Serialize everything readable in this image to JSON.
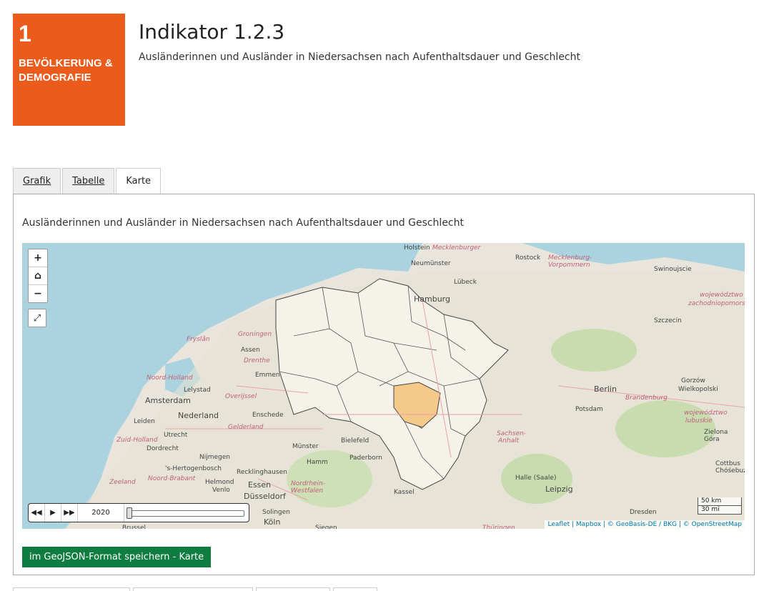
{
  "badge": {
    "number": "1",
    "category": "BEVÖLKERUNG & DEMOGRAFIE",
    "color": "#ea5b1c"
  },
  "header": {
    "title": "Indikator 1.2.3",
    "subtitle": "Ausländerinnen und Ausländer in Niedersachsen nach Aufenthaltsdauer und Geschlecht"
  },
  "tabs": [
    {
      "label": "Grafik"
    },
    {
      "label": "Tabelle"
    },
    {
      "label": "Karte"
    }
  ],
  "active_tab": "Karte",
  "panel": {
    "title": "Ausländerinnen und Ausländer in Niedersachsen nach Aufenthaltsdauer und Geschlecht"
  },
  "map": {
    "controls": {
      "zoom_in": "+",
      "home_icon": "home-icon",
      "zoom_out": "−",
      "fullscreen_icon": "fullscreen-icon"
    },
    "timebar": {
      "year": "2020",
      "rewind_icon": "rewind-icon",
      "play_icon": "play-icon",
      "forward_icon": "forward-icon"
    },
    "scale": {
      "km": "50 km",
      "mi": "30 mi"
    },
    "attribution": "Leaflet | Mapbox | © GeoBasis-DE / BKG | © OpenStreetMap",
    "highlight_color": "#f5c98a",
    "labels": [
      {
        "text": "Holstein",
        "cls": ""
      },
      {
        "text": "Mecklenburger",
        "cls": "region"
      },
      {
        "text": "Rostock",
        "cls": ""
      },
      {
        "text": "Mecklenburg-",
        "cls": "region"
      },
      {
        "text": "Vorpommern",
        "cls": "region"
      },
      {
        "text": "Neumünster",
        "cls": ""
      },
      {
        "text": "Lübeck",
        "cls": ""
      },
      {
        "text": "Swinoujscie",
        "cls": ""
      },
      {
        "text": "Hamburg",
        "cls": "big"
      },
      {
        "text": "województwo",
        "cls": "region"
      },
      {
        "text": "zachodniopomorskie",
        "cls": "region"
      },
      {
        "text": "Szczecin",
        "cls": ""
      },
      {
        "text": "Fryslân",
        "cls": "region"
      },
      {
        "text": "Groningen",
        "cls": "region"
      },
      {
        "text": "Assen",
        "cls": ""
      },
      {
        "text": "Drenthe",
        "cls": "region"
      },
      {
        "text": "Emmen",
        "cls": ""
      },
      {
        "text": "Noord-Holland",
        "cls": "region"
      },
      {
        "text": "Lelystad",
        "cls": ""
      },
      {
        "text": "Amsterdam",
        "cls": "big"
      },
      {
        "text": "Overijssel",
        "cls": "region"
      },
      {
        "text": "Nederland",
        "cls": "big"
      },
      {
        "text": "Enschede",
        "cls": ""
      },
      {
        "text": "Leiden",
        "cls": ""
      },
      {
        "text": "Utrecht",
        "cls": ""
      },
      {
        "text": "Gelderland",
        "cls": "region"
      },
      {
        "text": "Zuid-Holland",
        "cls": "region"
      },
      {
        "text": "Dordrecht",
        "cls": ""
      },
      {
        "text": "Nijmegen",
        "cls": ""
      },
      {
        "text": "'s-Hertogenbosch",
        "cls": ""
      },
      {
        "text": "Noord-Brabant",
        "cls": "region"
      },
      {
        "text": "Zeeland",
        "cls": "region"
      },
      {
        "text": "Helmond",
        "cls": ""
      },
      {
        "text": "Venlo",
        "cls": ""
      },
      {
        "text": "Düsseldorf",
        "cls": "big"
      },
      {
        "text": "Essen",
        "cls": "big"
      },
      {
        "text": "Nordrhein-",
        "cls": "region"
      },
      {
        "text": "Westfalen",
        "cls": "region"
      },
      {
        "text": "Recklinghausen",
        "cls": ""
      },
      {
        "text": "Münster",
        "cls": ""
      },
      {
        "text": "Bielefeld",
        "cls": ""
      },
      {
        "text": "Paderborn",
        "cls": ""
      },
      {
        "text": "Hamm",
        "cls": ""
      },
      {
        "text": "Solingen",
        "cls": ""
      },
      {
        "text": "Köln",
        "cls": "big"
      },
      {
        "text": "Siegen",
        "cls": ""
      },
      {
        "text": "Kassel",
        "cls": ""
      },
      {
        "text": "Berlin",
        "cls": "big"
      },
      {
        "text": "Brandenburg",
        "cls": "region"
      },
      {
        "text": "Potsdam",
        "cls": ""
      },
      {
        "text": "Gorzów",
        "cls": ""
      },
      {
        "text": "Wielkopolski",
        "cls": ""
      },
      {
        "text": "województwo",
        "cls": "region"
      },
      {
        "text": "lubuskie",
        "cls": "region"
      },
      {
        "text": "Zielona",
        "cls": ""
      },
      {
        "text": "Góra",
        "cls": ""
      },
      {
        "text": "Sachsen-",
        "cls": "region"
      },
      {
        "text": "Anhalt",
        "cls": "region"
      },
      {
        "text": "Cottbus",
        "cls": ""
      },
      {
        "text": "Chóśebuz",
        "cls": ""
      },
      {
        "text": "Halle (Saale)",
        "cls": ""
      },
      {
        "text": "Leipzig",
        "cls": "big"
      },
      {
        "text": "Dresden",
        "cls": ""
      },
      {
        "text": "Brussel",
        "cls": ""
      },
      {
        "text": "Thüringen",
        "cls": "region"
      }
    ]
  },
  "save_button": {
    "label": "im GeoJSON-Format speichern - Karte",
    "color": "#0e7d3f"
  }
}
